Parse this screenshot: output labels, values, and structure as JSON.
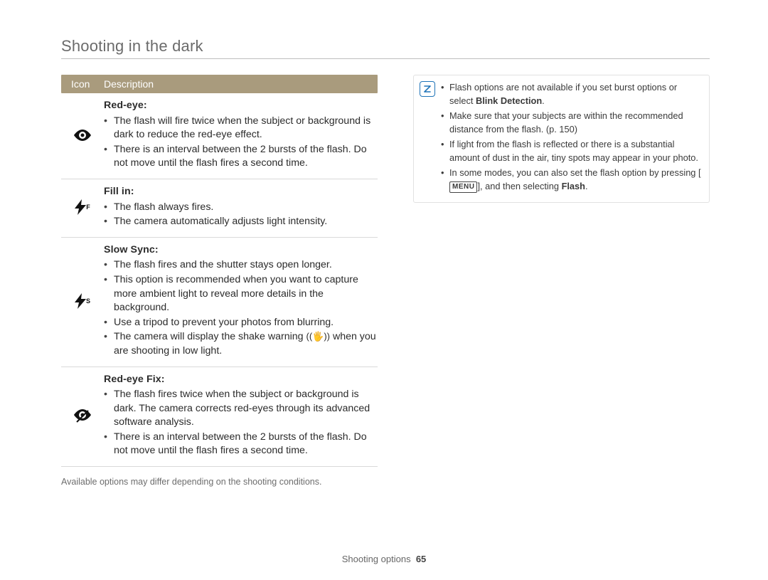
{
  "page_title": "Shooting in the dark",
  "table": {
    "head_icon": "Icon",
    "head_desc": "Description",
    "rows": [
      {
        "icon_name": "eye-icon",
        "icon_glyph": "👁",
        "title": "Red-eye",
        "bullets": [
          "The flash will fire twice when the subject or background is dark to reduce the red-eye effect.",
          "There is an interval between the 2 bursts of the flash. Do not move until the flash fires a second time."
        ]
      },
      {
        "icon_name": "flash-fillin-icon",
        "icon_glyph": "⚡",
        "icon_super": "F",
        "title": "Fill in",
        "bullets": [
          "The flash always fires.",
          "The camera automatically adjusts light intensity."
        ]
      },
      {
        "icon_name": "flash-slowsync-icon",
        "icon_glyph": "⚡",
        "icon_super": "S",
        "title": "Slow Sync",
        "bullets": [
          "The flash fires and the shutter stays open longer.",
          "This option is recommended when you want to capture more ambient light to reveal more details in the background.",
          "Use a tripod to prevent your photos from blurring.",
          "The camera will display the shake warning ((🖐)) when you are shooting in low light."
        ]
      },
      {
        "icon_name": "eye-redeyefix-icon",
        "icon_glyph": "👁⃠",
        "title": "Red-eye Fix",
        "bullets": [
          "The flash fires twice when the subject or background is dark. The camera corrects red-eyes through its advanced software analysis.",
          "There is an interval between the 2 bursts of the flash. Do not move until the flash fires a second time."
        ]
      }
    ]
  },
  "footnote": "Available options may differ depending on the shooting conditions.",
  "note": {
    "bullets": [
      {
        "pre": "Flash options are not available if you set burst options or select ",
        "strong": "Blink Detection",
        "post": "."
      },
      {
        "text": "Make sure that your subjects are within the recommended distance from the flash. (p. 150)"
      },
      {
        "text": "If light from the flash is reflected or there is a substantial amount of dust in the air, tiny spots may appear in your photo."
      },
      {
        "pre": "In some modes, you can also set the flash option by pressing [",
        "menu": "MENU",
        "mid": "], and then selecting ",
        "strong": "Flash",
        "post": "."
      }
    ]
  },
  "footer": {
    "section": "Shooting options",
    "page": "65"
  }
}
